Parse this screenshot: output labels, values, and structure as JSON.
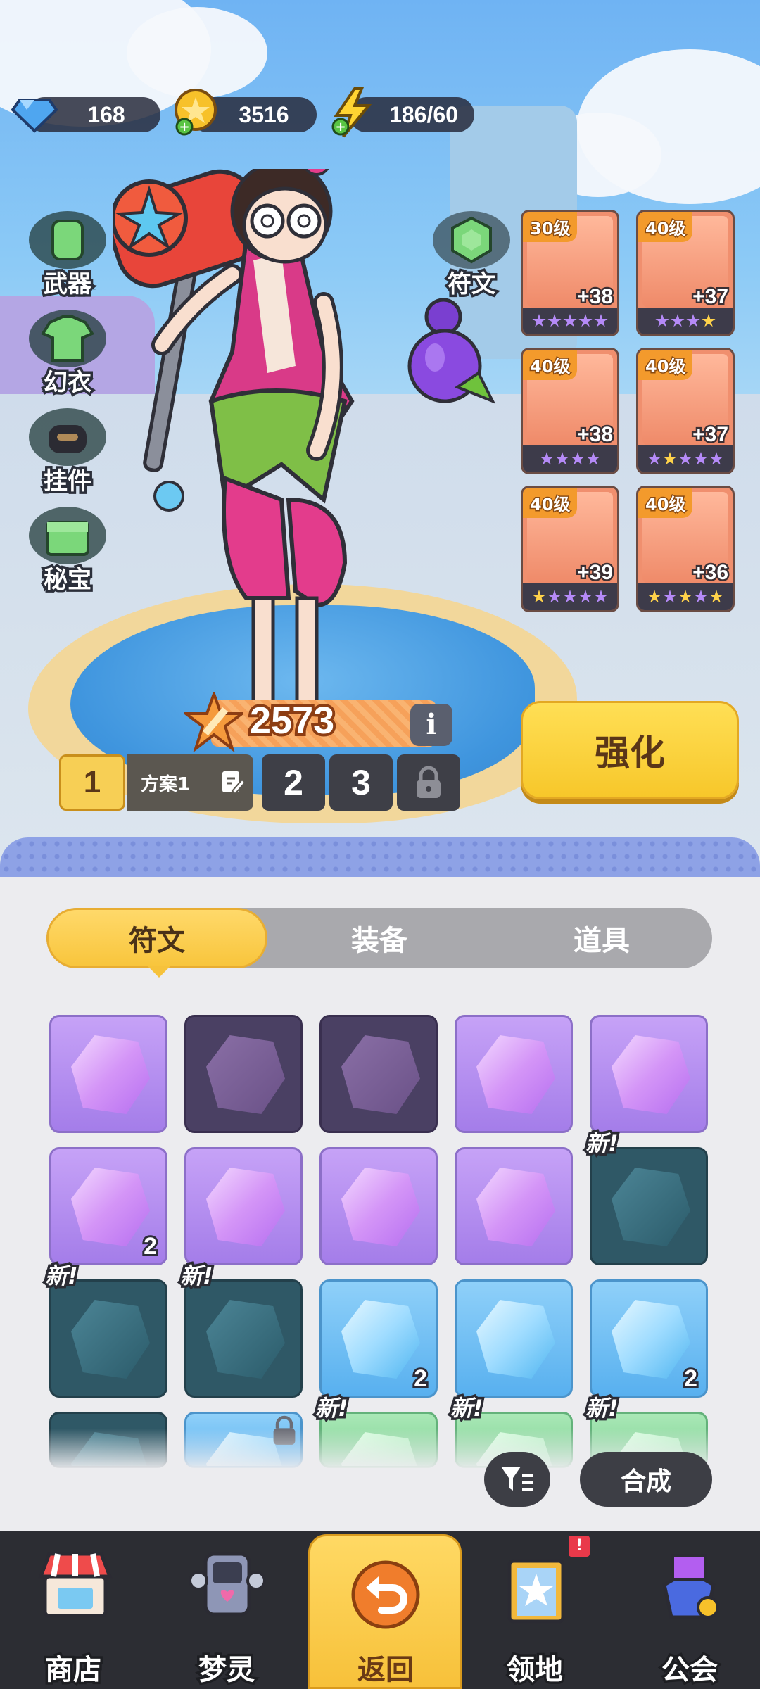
{
  "resources": {
    "gems": "168",
    "coins": "3516",
    "energy": "186/60"
  },
  "side_menu": {
    "weapon": "武器",
    "outfit": "幻衣",
    "pendant": "挂件",
    "treasure": "秘宝"
  },
  "rune_label": "符文",
  "equipment": [
    {
      "level": "30级",
      "bonus": "+38",
      "stars": [
        "p",
        "p",
        "p",
        "p",
        "p"
      ]
    },
    {
      "level": "40级",
      "bonus": "+37",
      "stars": [
        "p",
        "p",
        "p",
        "g"
      ]
    },
    {
      "level": "40级",
      "bonus": "+38",
      "stars": [
        "p",
        "p",
        "p",
        "p"
      ]
    },
    {
      "level": "40级",
      "bonus": "+37",
      "stars": [
        "p",
        "g",
        "p",
        "p",
        "p"
      ]
    },
    {
      "level": "40级",
      "bonus": "+39",
      "stars": [
        "g",
        "p",
        "p",
        "p",
        "p"
      ]
    },
    {
      "level": "40级",
      "bonus": "+36",
      "stars": [
        "g",
        "p",
        "g",
        "p",
        "g"
      ]
    }
  ],
  "power": "2573",
  "info": "i",
  "plans": {
    "p1": "1",
    "p1_name": "方案1",
    "p2": "2",
    "p3": "3"
  },
  "enhance": "强化",
  "tabs": {
    "runes": "符文",
    "equipment": "装备",
    "items": "道具"
  },
  "new_tag": "新!",
  "grid": [
    {
      "style": "purple",
      "count": ""
    },
    {
      "style": "dim",
      "count": ""
    },
    {
      "style": "dim",
      "count": ""
    },
    {
      "style": "purple",
      "count": ""
    },
    {
      "style": "purple",
      "count": ""
    },
    {
      "style": "purple",
      "count": "2"
    },
    {
      "style": "purple",
      "count": ""
    },
    {
      "style": "purple",
      "count": ""
    },
    {
      "style": "purple",
      "count": ""
    },
    {
      "style": "teal",
      "count": "",
      "new": true
    },
    {
      "style": "teal",
      "count": "",
      "new": true
    },
    {
      "style": "teal",
      "count": "",
      "new": true
    },
    {
      "style": "blue",
      "count": "2"
    },
    {
      "style": "blue",
      "count": ""
    },
    {
      "style": "blue",
      "count": "2"
    },
    {
      "style": "teal",
      "count": ""
    },
    {
      "style": "blue",
      "count": "",
      "locked": true
    },
    {
      "style": "green",
      "count": "",
      "new": true
    },
    {
      "style": "green",
      "count": "",
      "new": true
    },
    {
      "style": "green",
      "count": "",
      "new": true
    }
  ],
  "compose": "合成",
  "nav": {
    "shop": "商店",
    "dream_spirit": "梦灵",
    "back": "返回",
    "territory": "领地",
    "guild": "公会"
  },
  "colors": {
    "accent_yellow": "#f8c53c",
    "dark_bar": "#2c2d33",
    "rune_purple": "#a47de9",
    "rune_blue": "#58b0ef"
  }
}
